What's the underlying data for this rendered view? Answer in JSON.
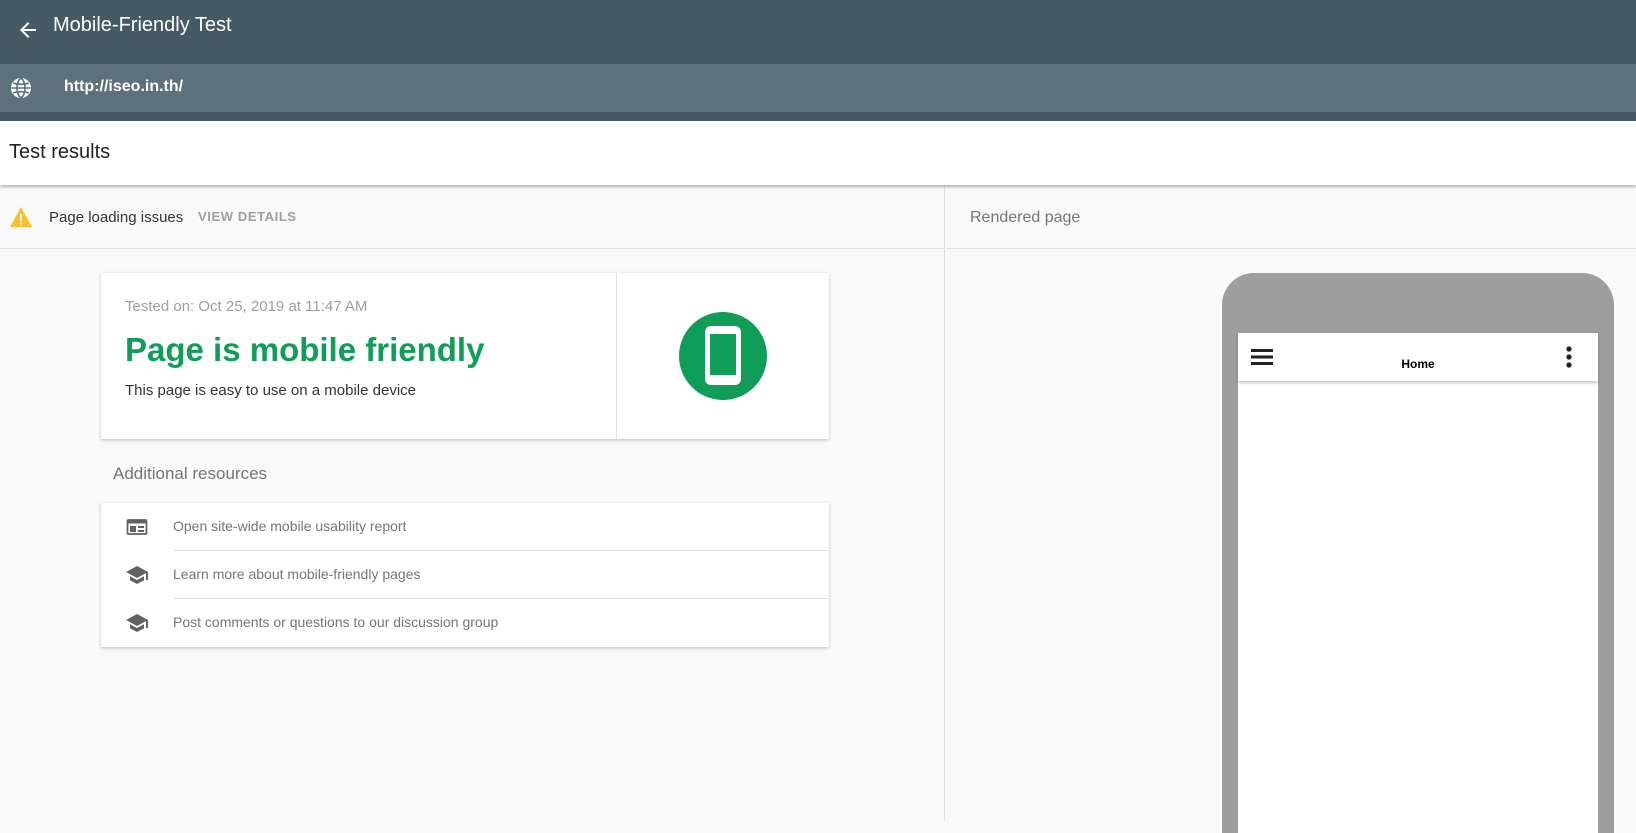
{
  "header": {
    "title": "Mobile-Friendly Test",
    "back_icon": "arrow-back-icon"
  },
  "url_bar": {
    "url": "http://iseo.in.th/",
    "icon": "globe-icon"
  },
  "results": {
    "title": "Test results"
  },
  "issues": {
    "text": "Page loading issues",
    "action_label": "VIEW DETAILS",
    "icon": "warning-icon",
    "icon_color": "#fbc02d"
  },
  "result_card": {
    "tested_on": "Tested on: Oct 25, 2019 at 11:47 AM",
    "verdict": "Page is mobile friendly",
    "verdict_color": "#0f9d58",
    "description": "This page is easy to use on a mobile device",
    "icon": "smartphone-icon"
  },
  "additional_resources": {
    "title": "Additional resources",
    "items": [
      {
        "label": "Open site-wide mobile usability report",
        "icon": "web-layout-icon"
      },
      {
        "label": "Learn more about mobile-friendly pages",
        "icon": "school-icon"
      },
      {
        "label": "Post comments or questions to our discussion group",
        "icon": "school-icon"
      }
    ]
  },
  "rendered": {
    "label": "Rendered page",
    "preview_title": "Home",
    "menu_icon": "hamburger-menu-icon",
    "more_icon": "more-vert-icon"
  },
  "colors": {
    "header_bg": "#455a64",
    "url_bar_bg": "#5c717b",
    "success": "#0f9d58"
  }
}
